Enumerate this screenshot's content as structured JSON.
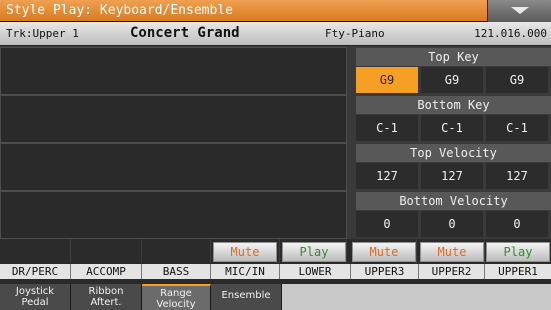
{
  "title": "Style Play: Keyboard/Ensemble",
  "track_info": {
    "track": "Trk:Upper 1",
    "sound": "Concert Grand",
    "bank": "Fty-Piano",
    "address": "121.016.000"
  },
  "sections": {
    "top_key": {
      "label": "Top Key",
      "values": [
        "G9",
        "G9",
        "G9"
      ],
      "selected_index": 0
    },
    "bottom_key": {
      "label": "Bottom Key",
      "values": [
        "C-1",
        "C-1",
        "C-1"
      ]
    },
    "top_velocity": {
      "label": "Top Velocity",
      "values": [
        "127",
        "127",
        "127"
      ]
    },
    "bottom_velocity": {
      "label": "Bottom Velocity",
      "values": [
        "0",
        "0",
        "0"
      ]
    }
  },
  "mute_play": [
    "",
    "",
    "",
    "Mute",
    "Play",
    "Mute",
    "Mute",
    "Play"
  ],
  "tracks": [
    "DR/PERC",
    "ACCOMP",
    "BASS",
    "MIC/IN",
    "LOWER",
    "UPPER3",
    "UPPER2",
    "UPPER1"
  ],
  "tabs": [
    {
      "line1": "Joystick",
      "line2": "Pedal"
    },
    {
      "line1": "Ribbon",
      "line2": "Aftert."
    },
    {
      "line1": "Range",
      "line2": "Velocity"
    },
    {
      "line1": "Ensemble",
      "line2": ""
    }
  ],
  "icons": {
    "menu": "chevron-down-icon"
  },
  "colors": {
    "accent": "#f5a025",
    "mute": "#e06a23",
    "play": "#2f8f2f"
  }
}
